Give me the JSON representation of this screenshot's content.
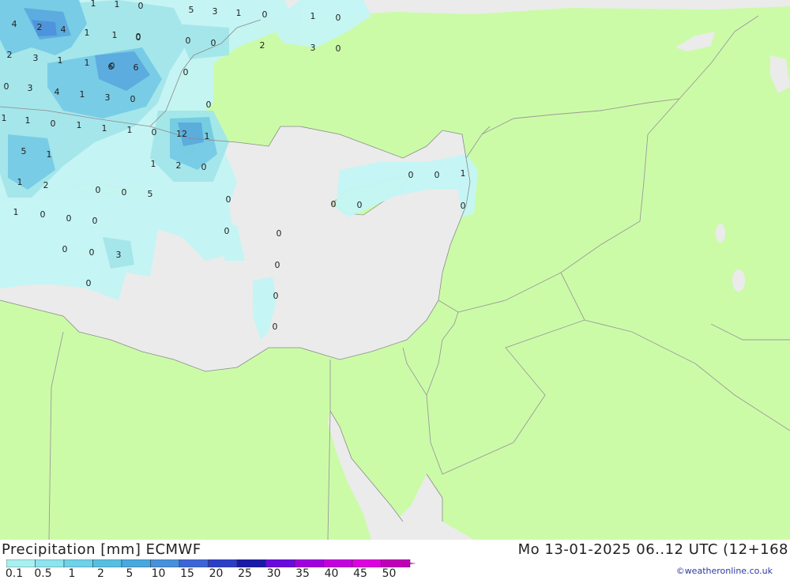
{
  "header": {
    "title": "Precipitation [mm] ECMWF",
    "datetime": "Mo 13-01-2025 06..12 UTC (12+168",
    "credit": "©weatheronline.co.uk"
  },
  "legend": {
    "ticks": [
      "0.1",
      "0.5",
      "1",
      "2",
      "5",
      "10",
      "15",
      "20",
      "25",
      "30",
      "35",
      "40",
      "45",
      "50"
    ],
    "colors": [
      "#a8f0f0",
      "#8ce4ee",
      "#6ed2e8",
      "#55bfe3",
      "#48a8e0",
      "#4690dc",
      "#3c66d8",
      "#2c3ec8",
      "#1a1aa8",
      "#6a0ae0",
      "#a000e0",
      "#c400e0",
      "#e000e0",
      "#c000b8"
    ]
  },
  "colors": {
    "land": "#ccfba8",
    "sea": "#ebebeb",
    "precip_light": "#c4f5f5",
    "precip_mid": "#a2e6ec",
    "precip_heavy": "#72cbe6",
    "precip_core": "#55a9df",
    "border": "#9a9a9a"
  },
  "map_labels": [
    "4",
    "2",
    "4",
    "1",
    "1",
    "0",
    "1",
    "5",
    "3",
    "1",
    "0",
    "1",
    "0",
    "2",
    "3",
    "1",
    "1",
    "0",
    "0",
    "0",
    "0",
    "1",
    "0",
    "2",
    "3",
    "0",
    "6",
    "6",
    "0",
    "0",
    "0",
    "3",
    "4",
    "1",
    "3",
    "0",
    "1",
    "1",
    "0",
    "1",
    "1",
    "1",
    "12",
    "1",
    "5",
    "1",
    "0",
    "1",
    "2",
    "0",
    "1",
    "2",
    "0",
    "0",
    "5",
    "0",
    "0",
    "0",
    "0",
    "0",
    "1",
    "0",
    "1",
    "0",
    "0",
    "0",
    "0",
    "0",
    "0",
    "0",
    "3",
    "0",
    "0",
    "0",
    "0"
  ]
}
